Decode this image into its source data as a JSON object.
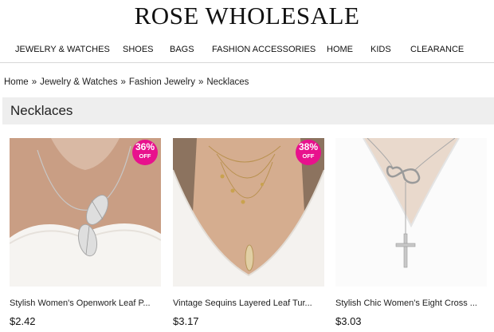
{
  "header": {
    "logo": "ROSE WHOLESALE"
  },
  "nav": {
    "items": [
      {
        "label": "JEWELRY & WATCHES"
      },
      {
        "label": "SHOES"
      },
      {
        "label": "BAGS"
      },
      {
        "label": "FASHION ACCESSORIES"
      },
      {
        "label": "HOME"
      },
      {
        "label": "KIDS"
      },
      {
        "label": "CLEARANCE"
      }
    ]
  },
  "breadcrumb": {
    "items": [
      "Home",
      "Jewelry & Watches",
      "Fashion Jewelry",
      "Necklaces"
    ],
    "separator": "»"
  },
  "category": {
    "title": "Necklaces"
  },
  "products": [
    {
      "title": "Stylish Women's Openwork Leaf P...",
      "price": "$2.42",
      "discount": "36%",
      "discount_label": "OFF"
    },
    {
      "title": "Vintage Sequins Layered Leaf Tur...",
      "price": "$3.17",
      "discount": "38%",
      "discount_label": "OFF"
    },
    {
      "title": "Stylish Chic Women's Eight Cross ...",
      "price": "$3.03"
    }
  ],
  "colors": {
    "badge": "#e8118d",
    "category_bar": "#eeeeee"
  }
}
